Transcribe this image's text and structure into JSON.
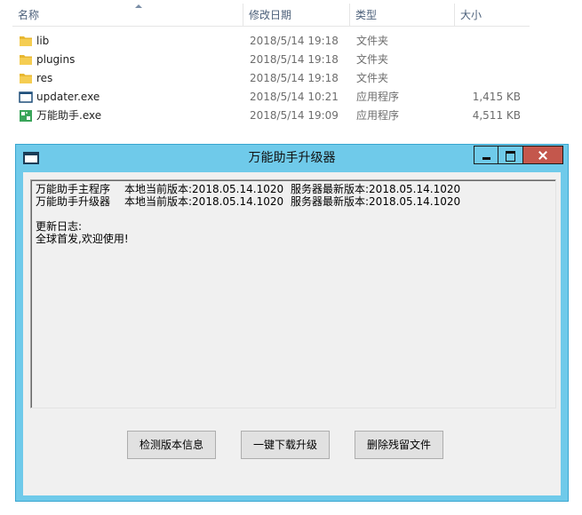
{
  "explorer": {
    "columns": {
      "name": "名称",
      "date": "修改日期",
      "type": "类型",
      "size": "大小"
    },
    "files": [
      {
        "name": "lib",
        "date": "2018/5/14 19:18",
        "type": "文件夹",
        "size": "",
        "icon": "folder-icon"
      },
      {
        "name": "plugins",
        "date": "2018/5/14 19:18",
        "type": "文件夹",
        "size": "",
        "icon": "folder-icon"
      },
      {
        "name": "res",
        "date": "2018/5/14 19:18",
        "type": "文件夹",
        "size": "",
        "icon": "folder-icon"
      },
      {
        "name": "updater.exe",
        "date": "2018/5/14 10:21",
        "type": "应用程序",
        "size": "1,415 KB",
        "icon": "window-app-icon"
      },
      {
        "name": "万能助手.exe",
        "date": "2018/5/14 19:09",
        "type": "应用程序",
        "size": "4,511 KB",
        "icon": "green-app-icon"
      }
    ]
  },
  "window": {
    "title": "万能助手升级器",
    "log": {
      "rows": [
        {
          "program": "万能助手主程序",
          "local": "本地当前版本:2018.05.14.1020",
          "server": "服务器最新版本:2018.05.14.1020"
        },
        {
          "program": "万能助手升级器",
          "local": "本地当前版本:2018.05.14.1020",
          "server": "服务器最新版本:2018.05.14.1020"
        }
      ],
      "changelog_title": "更新日志:",
      "changelog_text": "全球首发,欢迎使用!"
    },
    "buttons": {
      "check": "检测版本信息",
      "upgrade": "一键下载升级",
      "delete": "删除残留文件"
    }
  },
  "colors": {
    "window_frame": "#6fcaea",
    "close_button": "#c4574c",
    "folder": "#e8b730",
    "header_text": "#4c607a"
  }
}
